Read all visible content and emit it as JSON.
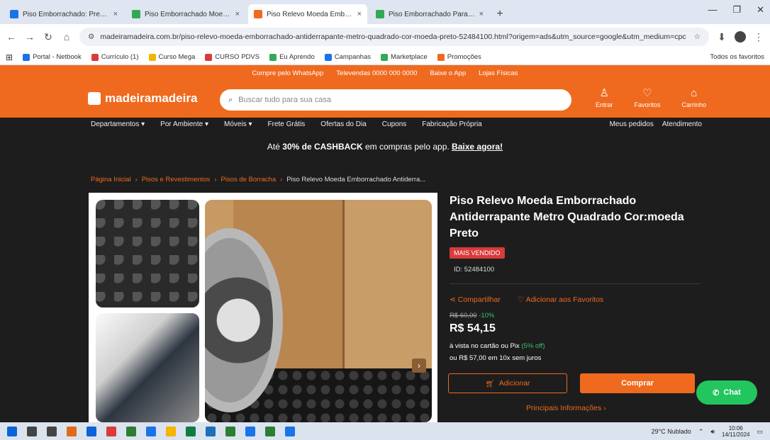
{
  "browser": {
    "tabs": [
      {
        "title": "Piso Emborrachado: Preços e Ofertas",
        "color": "#1a73e8",
        "active": false
      },
      {
        "title": "Piso Emborrachado Moeda Preto",
        "color": "#34a853",
        "active": false
      },
      {
        "title": "Piso Relevo Moeda Emborrachado",
        "color": "#ef6a1f",
        "active": true
      },
      {
        "title": "Piso Emborrachado Paraíba",
        "color": "#34a853",
        "active": false
      }
    ],
    "new_tab": "+",
    "url": "madeiramadeira.com.br/piso-relevo-moeda-emborrachado-antiderrapante-metro-quadrado-cor-moeda-preto-52484100.html?origem=ads&utm_source=google&utm_medium=cpc",
    "bookmarks": [
      {
        "label": "Portal - Netbook",
        "color": "#1a73e8"
      },
      {
        "label": "Currículo (1)",
        "color": "#d93a3a"
      },
      {
        "label": "Curso Mega",
        "color": "#f4b400"
      },
      {
        "label": "CURSO PDVS",
        "color": "#d93a3a"
      },
      {
        "label": "Eu Aprendo",
        "color": "#34a853"
      },
      {
        "label": "Campanhas",
        "color": "#1a73e8"
      },
      {
        "label": "Marketplace",
        "color": "#34a853"
      },
      {
        "label": "Promoções",
        "color": "#ef6a1f"
      }
    ],
    "bookmarks_right": "Todos os favoritos"
  },
  "site": {
    "promo_items": [
      "Compre pelo WhatsApp",
      "Televendas 0000 000 0000",
      "Baixe o App",
      "Lojas Físicas"
    ],
    "logo": "madeiramadeira",
    "search_placeholder": "Buscar tudo para sua casa",
    "header_icons": [
      {
        "glyph": "♙",
        "label": "Entrar"
      },
      {
        "glyph": "♡",
        "label": "Favoritos"
      },
      {
        "glyph": "⌂",
        "label": "Carrinho"
      }
    ],
    "nav_left": [
      "Departamentos ▾",
      "Por Ambiente ▾",
      "Móveis ▾",
      "Frete Grátis",
      "Ofertas do Dia",
      "Cupons",
      "Fabricação Própria"
    ],
    "nav_right": [
      "Meus pedidos",
      "Atendimento"
    ],
    "cashback_prefix": "Até",
    "cashback_strong": "30% de CASHBACK",
    "cashback_mid": "em compras pelo app.",
    "cashback_link": "Baixe agora!",
    "breadcrumb": [
      "Página Inicial",
      "Pisos e Revestimentos",
      "Pisos de Borracha"
    ],
    "breadcrumb_current": "Piso Relevo Moeda Emborrachado Antiderra..."
  },
  "product": {
    "title": "Piso Relevo Moeda Emborrachado Antiderrapante Metro Quadrado Cor:moeda Preto",
    "badge": "MAIS VENDIDO",
    "id_text": "ID: 52484100",
    "share": "Compartilhar",
    "favorite": "Adicionar aos Favoritos",
    "old_price_label": "R$ 60,00",
    "old_price_discount": "-10%",
    "price": "R$ 54,15",
    "pay_text": "à vista no cartão ou Pix",
    "pay_discount": "(5% off)",
    "installments": "ou R$ 57,00 em 10x sem juros",
    "add_button": "Adicionar",
    "buy_button": "Comprar",
    "main_info": "Principais Informações  ›",
    "next_image": "›"
  },
  "chat": {
    "label": "Chat"
  },
  "taskbar": {
    "icon_colors": [
      "#0a64d6",
      "#444",
      "#444",
      "#e06b16",
      "#0a64d6",
      "#d93a3a",
      "#2d7d32",
      "#1a73e8",
      "#f4b400",
      "#107c41",
      "#1d6fb8",
      "#2d7d32",
      "#1a73e8",
      "#2d7d32",
      "#1a73e8"
    ],
    "weather": "29°C  Nublado",
    "time": "10:06",
    "date": "14/11/2024"
  }
}
